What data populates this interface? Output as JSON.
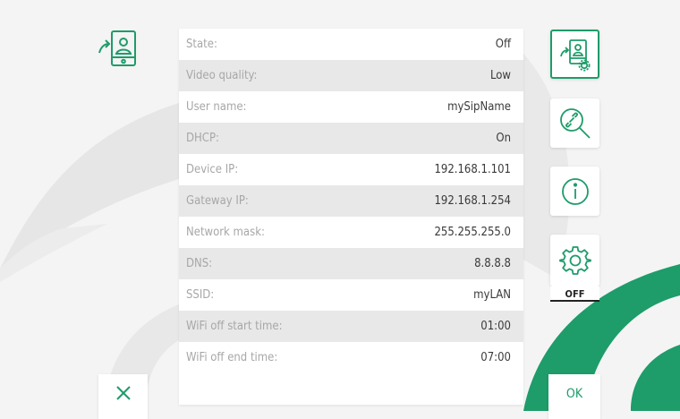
{
  "rows": [
    {
      "label": "State:",
      "value": "Off"
    },
    {
      "label": "Video quality:",
      "value": "Low"
    },
    {
      "label": "User name:",
      "value": "mySipName"
    },
    {
      "label": "DHCP:",
      "value": "On"
    },
    {
      "label": "Device IP:",
      "value": "192.168.1.101"
    },
    {
      "label": "Gateway IP:",
      "value": "192.168.1.254"
    },
    {
      "label": "Network mask:",
      "value": "255.255.255.0"
    },
    {
      "label": "DNS:",
      "value": "8.8.8.8"
    },
    {
      "label": "SSID:",
      "value": "myLAN"
    },
    {
      "label": "WiFi off start time:",
      "value": "01:00"
    },
    {
      "label": "WiFi off end time:",
      "value": "07:00"
    }
  ],
  "side": {
    "toggle_label": "OFF"
  },
  "footer": {
    "ok_label": "OK"
  },
  "icons": {
    "header": "sip-forward-icon",
    "sip_settings": "sip-settings-icon",
    "link": "link-search-icon",
    "info": "info-icon",
    "gear": "gear-icon",
    "close": "close-icon"
  },
  "colors": {
    "accent": "#1e9c6a",
    "background": "#f4f4f4",
    "row_alt": "#e8e8e8"
  }
}
